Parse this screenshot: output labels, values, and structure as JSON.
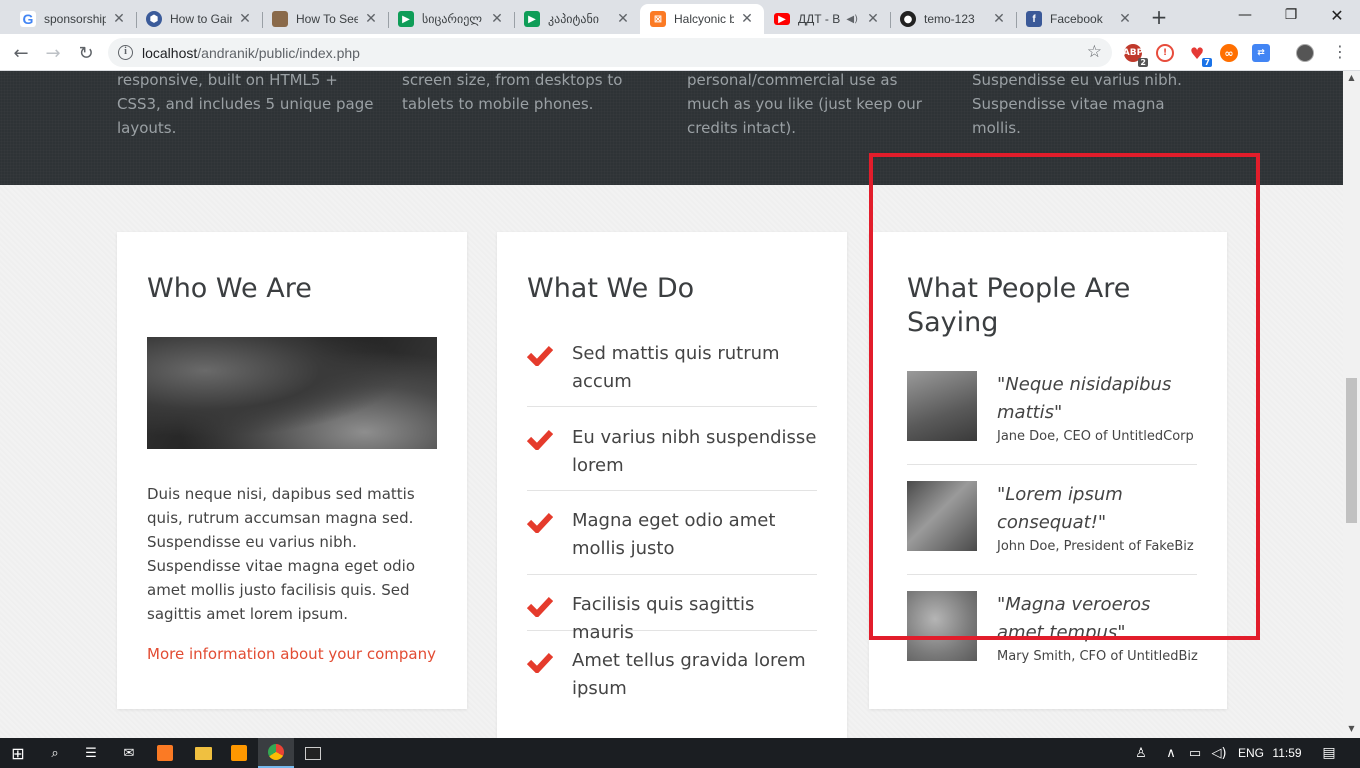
{
  "browser": {
    "tabs": [
      {
        "label": "sponsorship",
        "favicon": "google-icon",
        "color": "#ffffff"
      },
      {
        "label": "How to Gain",
        "favicon": "hex-icon",
        "color": "#3b5b9a"
      },
      {
        "label": "How To See",
        "favicon": "photo-icon",
        "color": "#8a6a4a"
      },
      {
        "label": "სიცარიელ",
        "favicon": "play-icon",
        "color": "#0f9d58"
      },
      {
        "label": "კაპიტანი",
        "favicon": "play-icon",
        "color": "#0f9d58"
      },
      {
        "label": "Halcyonic b",
        "favicon": "xampp-icon",
        "color": "#fb7a24"
      },
      {
        "label": "ДДТ - В",
        "favicon": "youtube-icon",
        "color": "#ff0000"
      },
      {
        "label": "temo-123",
        "favicon": "github-icon",
        "color": "#222222"
      },
      {
        "label": "Facebook",
        "favicon": "facebook-icon",
        "color": "#3b5998"
      }
    ],
    "url_host": "localhost",
    "url_path": "/andranik/public/index.php",
    "extensions": [
      {
        "name": "adblock-icon",
        "badge": "2",
        "color": "#c0392b"
      },
      {
        "name": "alert-icon",
        "badge": "",
        "color": "#e74c3c"
      },
      {
        "name": "heart-icon",
        "badge": "7",
        "color": "#e53935"
      },
      {
        "name": "infinity-icon",
        "badge": "",
        "color": "#ff6f00"
      },
      {
        "name": "translate-icon",
        "badge": "",
        "color": "#4285f4"
      },
      {
        "name": "profile-avatar",
        "badge": "",
        "color": "#555555"
      }
    ]
  },
  "features": [
    {
      "text": "responsive, built on HTML5 + CSS3, and includes 5 unique page layouts."
    },
    {
      "text": "screen size, from desktops to tablets to mobile phones."
    },
    {
      "text": "personal/commercial use as much as you like (just keep our credits intact)."
    },
    {
      "text": "Suspendisse eu varius nibh. Suspendisse vitae magna mollis."
    }
  ],
  "who": {
    "title": "Who We Are",
    "body": "Duis neque nisi, dapibus sed mattis quis, rutrum accumsan magna sed. Suspendisse eu varius nibh. Suspendisse vitae magna eget odio amet mollis justo facilisis quis. Sed sagittis amet lorem ipsum.",
    "link": "More information about your company"
  },
  "what": {
    "title": "What We Do",
    "items": [
      "Sed mattis quis rutrum accum",
      "Eu varius nibh suspendisse lorem",
      "Magna eget odio amet mollis justo",
      "Facilisis quis sagittis mauris",
      "Amet tellus gravida lorem ipsum"
    ]
  },
  "people": {
    "title": "What People Are Saying",
    "testimonials": [
      {
        "quote": "\"Neque nisidapibus mattis\"",
        "author": "Jane Doe, CEO of UntitledCorp"
      },
      {
        "quote": "\"Lorem ipsum consequat!\"",
        "author": "John Doe, President of FakeBiz"
      },
      {
        "quote": "\"Magna veroeros amet tempus\"",
        "author": "Mary Smith, CFO of UntitledBiz"
      }
    ]
  },
  "taskbar": {
    "language": "ENG",
    "time": "11:59"
  },
  "colors": {
    "accent": "#e24c33",
    "highlight": "#e21d2b",
    "dark_band": "#2e3336"
  }
}
